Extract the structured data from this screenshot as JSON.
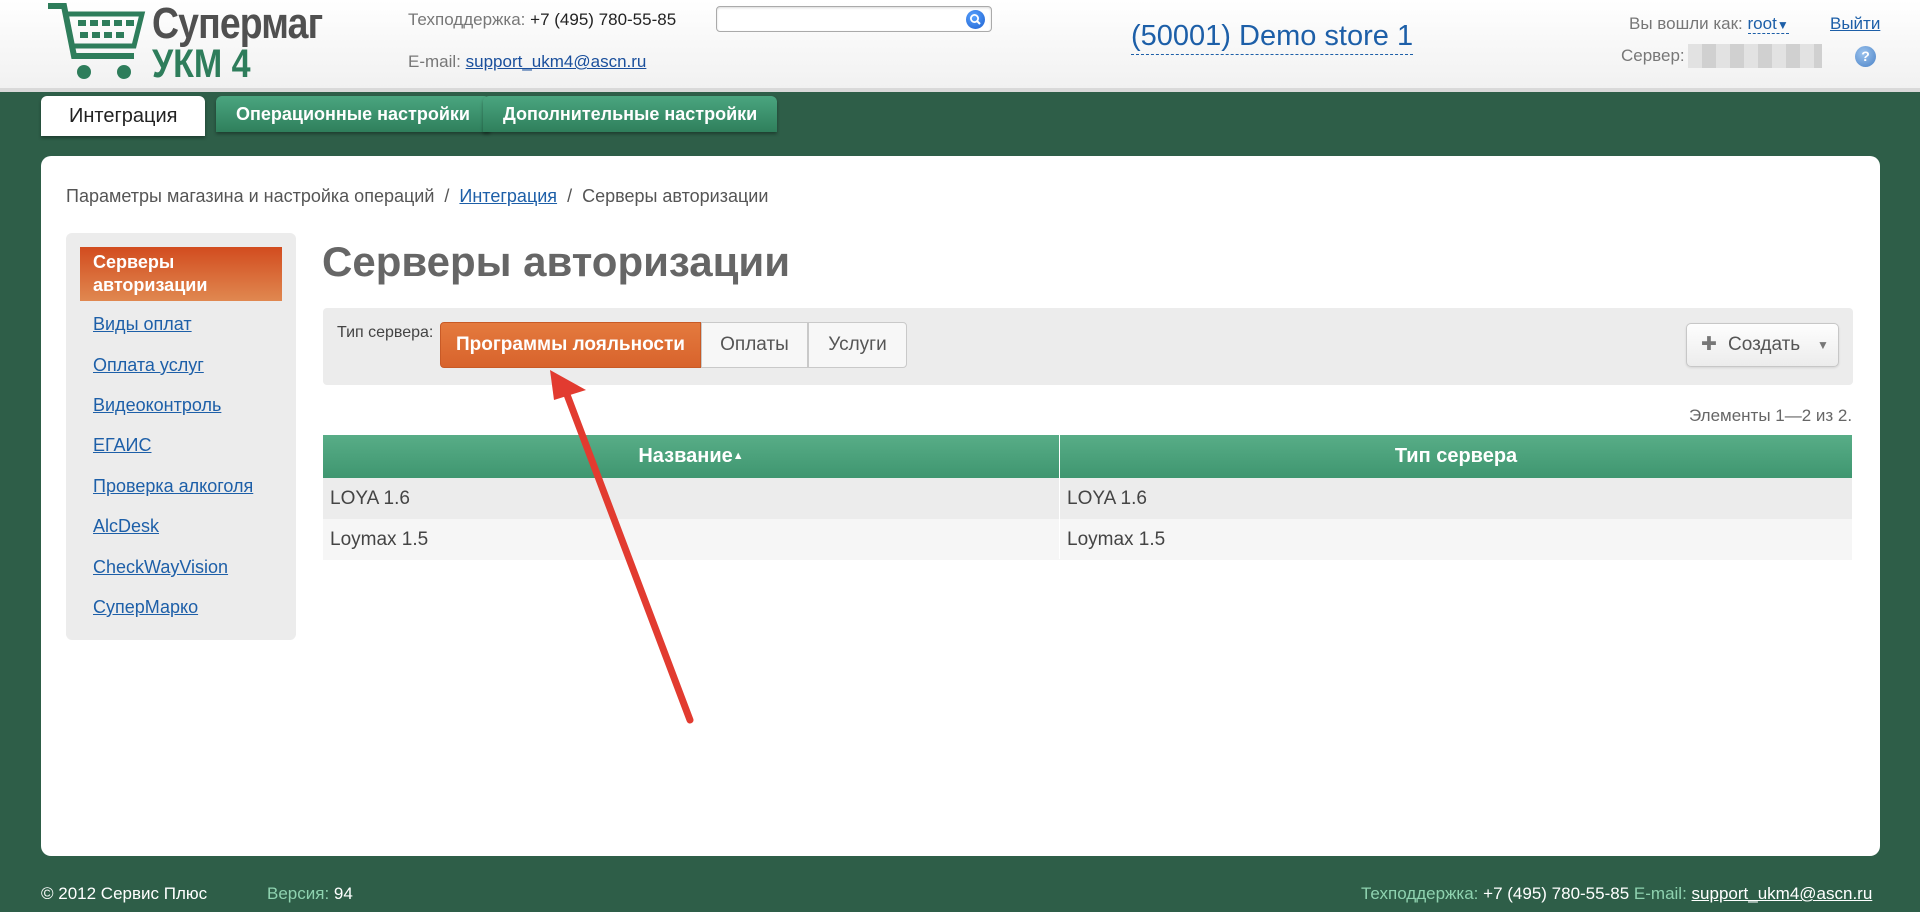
{
  "header": {
    "logo_line1": "Супермаг",
    "logo_line2": "УКМ 4",
    "support_label": "Техподдержка:",
    "support_phone": "+7 (495) 780-55-85",
    "email_label": "E-mail:",
    "email": "support_ukm4@ascn.ru",
    "search_placeholder": "",
    "store": "(50001) Demo store 1",
    "logged_in_label": "Вы вошли как:",
    "user": "root",
    "logout": "Выйти",
    "server_label": "Сервер:",
    "help": "?"
  },
  "tabs": [
    {
      "label": "Интеграция"
    },
    {
      "label": "Операционные настройки"
    },
    {
      "label": "Дополнительные настройки"
    }
  ],
  "breadcrumb": {
    "root": "Параметры магазина и настройка операций",
    "sep1": "/",
    "link": "Интеграция",
    "sep2": "/",
    "current": "Серверы авторизации"
  },
  "sidebar": {
    "items": [
      {
        "label": "Серверы авторизации"
      },
      {
        "label": "Виды оплат"
      },
      {
        "label": "Оплата услуг"
      },
      {
        "label": "Видеоконтроль"
      },
      {
        "label": "ЕГАИС"
      },
      {
        "label": "Проверка алкоголя"
      },
      {
        "label": "AlcDesk"
      },
      {
        "label": "CheckWayVision"
      },
      {
        "label": "СуперМарко"
      }
    ]
  },
  "main": {
    "title": "Серверы авторизации",
    "filter_label": "Тип сервера:",
    "segments": [
      {
        "label": "Программы лояльности"
      },
      {
        "label": "Оплаты"
      },
      {
        "label": "Услуги"
      }
    ],
    "create_label": "Создать",
    "counter": "Элементы 1—2 из 2."
  },
  "table": {
    "columns": [
      "Название",
      "Тип сервера"
    ],
    "rows": [
      [
        "LOYA 1.6",
        "LOYA 1.6"
      ],
      [
        "Loymax 1.5",
        "Loymax 1.5"
      ]
    ]
  },
  "footer": {
    "copyright": "© 2012 Сервис Плюс",
    "version_label": "Версия:",
    "version": "94",
    "support_label": "Техподдержка:",
    "support_phone": "+7 (495) 780-55-85",
    "email_label": "E-mail:",
    "email": "support_ukm4@ascn.ru"
  },
  "colors": {
    "brand_green": "#2e5e48",
    "accent_orange": "#d8632c",
    "link_blue": "#1d5fa8",
    "annotation_red": "#e23b30"
  }
}
